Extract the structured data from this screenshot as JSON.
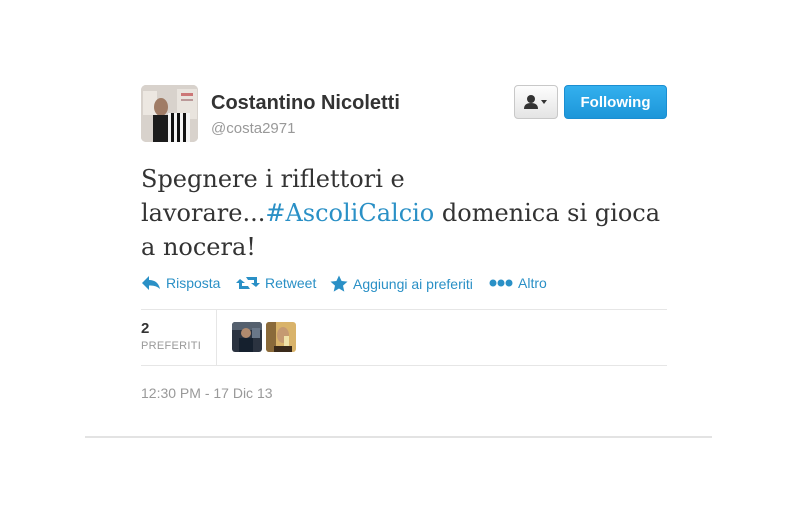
{
  "author": {
    "name": "Costantino Nicoletti",
    "handle": "@costa2971"
  },
  "follow_button_label": "Following",
  "tweet": {
    "text_before": "Spegnere i riflettori e lavorare...",
    "hashtag": "#AscoliCalcio",
    "text_after": " domenica si gioca a nocera!"
  },
  "actions": {
    "reply": "Risposta",
    "retweet": "Retweet",
    "favorite": "Aggiungi ai preferiti",
    "more": "Altro"
  },
  "stats": {
    "favorites_count": "2",
    "favorites_label": "PREFERITI"
  },
  "timestamp": "12:30 PM - 17 Dic 13",
  "colors": {
    "link": "#2a90c6",
    "follow_button": "#2aa3e6",
    "muted_text": "#999999"
  },
  "icons": [
    "user-menu-icon",
    "reply-icon",
    "retweet-icon",
    "star-icon",
    "more-dots-icon"
  ]
}
